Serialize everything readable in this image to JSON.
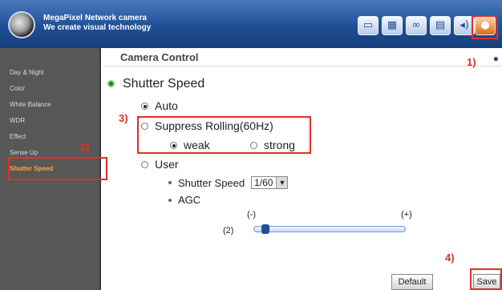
{
  "app": {
    "brand_line1": "MegaPixel Network camera",
    "brand_line2": "We create visual technology"
  },
  "toolbar": {
    "icons": [
      "monitor-icon",
      "grid-icon",
      "link-icon",
      "storage-icon",
      "audio-icon",
      "camera-icon"
    ],
    "active": "camera-icon"
  },
  "sidebar": {
    "items": [
      {
        "label": "Day & Night"
      },
      {
        "label": "Color"
      },
      {
        "label": "White Balance"
      },
      {
        "label": "WDR"
      },
      {
        "label": "Effect"
      },
      {
        "label": "Sense Up"
      },
      {
        "label": "Shutter Speed"
      }
    ],
    "selected": "Shutter Speed"
  },
  "content": {
    "title": "Camera Control",
    "section_title": "Shutter Speed",
    "options": {
      "auto": "Auto",
      "suppress": "Suppress Rolling(60Hz)",
      "weak": "weak",
      "strong": "strong",
      "user": "User"
    },
    "shutter_label": "Shutter Speed",
    "shutter_value": "1/60",
    "agc_label": "AGC",
    "agc_min": "(-)",
    "agc_max": "(+)",
    "agc_value": "(2)",
    "agc_level": 0.05
  },
  "buttons": {
    "default": "Default",
    "save": "Save"
  },
  "callouts": {
    "c1": "1)",
    "c2": "2)",
    "c3": "3)",
    "c4": "4)"
  },
  "colors": {
    "header": "#1f4f96",
    "sidebar": "#575757",
    "selected_item": "#ffa640",
    "callout": "#e0302a"
  }
}
